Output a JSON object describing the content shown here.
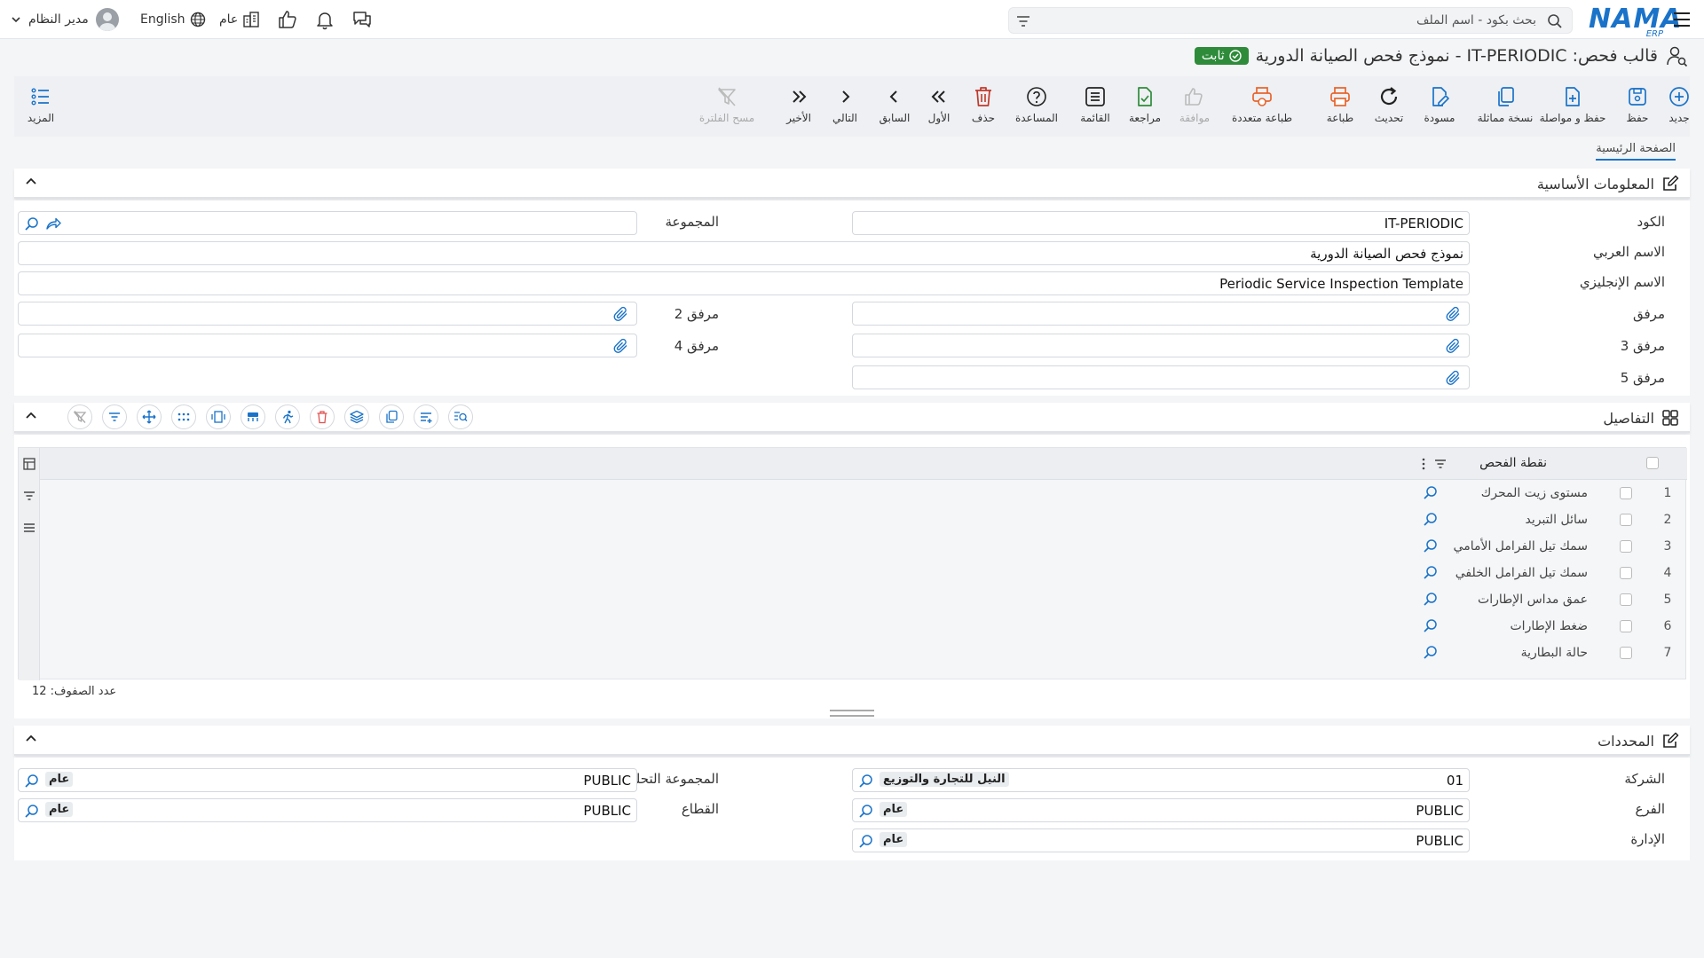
{
  "topbar": {
    "user_name": "مدير النظام",
    "language": "English",
    "scope": "عام",
    "search_placeholder": "بحث بكود - اسم الملف",
    "logo_text": "NAMA",
    "logo_sub": "ERP"
  },
  "page": {
    "title": "قالب فحص: IT-PERIODIC - نموذج فحص الصيانة الدورية",
    "status": "ثابت"
  },
  "toolbar": {
    "new": "جديد",
    "save": "حفظ",
    "save_continue": "حفظ و مواصلة",
    "duplicate": "نسخة مماثلة",
    "draft": "مسودة",
    "refresh": "تحديث",
    "print": "طباعة",
    "multi_print": "طباعة متعددة",
    "approve": "موافقة",
    "review": "مراجعة",
    "list": "القائمة",
    "help": "المساعدة",
    "delete": "حذف",
    "first": "الأول",
    "previous": "السابق",
    "next": "التالي",
    "last": "الأخير",
    "clear_filter": "مسح الفلترة",
    "more": "المزيد"
  },
  "tabs": {
    "main": "الصفحة الرئيسية"
  },
  "basic": {
    "section_title": "المعلومات الأساسية",
    "code_label": "الكود",
    "code_value": "IT-PERIODIC",
    "group_label": "المجموعة",
    "arabic_name_label": "الاسم العربي",
    "arabic_name_value": "نموذج فحص الصيانة الدورية",
    "english_name_label": "الاسم الإنجليزي",
    "english_name_value": "Periodic Service Inspection Template",
    "attachment_label": "مرفق",
    "attachment2_label": "مرفق 2",
    "attachment3_label": "مرفق 3",
    "attachment4_label": "مرفق 4",
    "attachment5_label": "مرفق 5"
  },
  "details": {
    "section_title": "التفاصيل",
    "column_header": "نقطة الفحص",
    "rows": [
      {
        "num": "1",
        "text": "مستوى زيت المحرك"
      },
      {
        "num": "2",
        "text": "سائل التبريد"
      },
      {
        "num": "3",
        "text": "سمك تيل الفرامل الأمامي"
      },
      {
        "num": "4",
        "text": "سمك تيل الفرامل الخلفي"
      },
      {
        "num": "5",
        "text": "عمق مداس الإطارات"
      },
      {
        "num": "6",
        "text": "ضغط الإطارات"
      },
      {
        "num": "7",
        "text": "حالة البطارية"
      }
    ],
    "row_count_label": "عدد الصفوف: 12"
  },
  "dimensions": {
    "section_title": "المحددات",
    "company_label": "الشركة",
    "company_code": "01",
    "company_name": "النيل للتجارة والتوزيع",
    "analytic_group_label": "المجموعة التحليلية",
    "analytic_group_code": "PUBLIC",
    "analytic_group_name": "عام",
    "branch_label": "الفرع",
    "branch_code": "PUBLIC",
    "branch_name": "عام",
    "sector_label": "القطاع",
    "sector_code": "PUBLIC",
    "sector_name": "عام",
    "department_label": "الإدارة",
    "department_code": "PUBLIC",
    "department_name": "عام"
  },
  "colors": {
    "accent": "#1a73c9",
    "status_green": "#2e8b3a",
    "delete_red": "#c0392b",
    "print_orange": "#e8642b"
  }
}
